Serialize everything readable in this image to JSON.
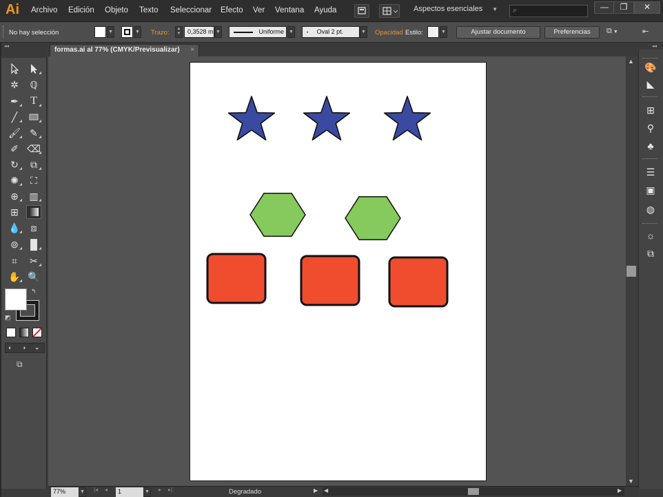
{
  "app": {
    "logo": "Ai"
  },
  "menu": [
    "Archivo",
    "Edición",
    "Objeto",
    "Texto",
    "Seleccionar",
    "Efecto",
    "Ver",
    "Ventana",
    "Ayuda"
  ],
  "workspace": {
    "label": "Aspectos esenciales"
  },
  "search": {
    "placeholder": ""
  },
  "window_controls": {
    "minimize": "—",
    "restore": "❐",
    "close": "✕"
  },
  "control_bar": {
    "selection_status": "No hay selección",
    "stroke_label": "Trazo:",
    "stroke_weight": "0,3528 m",
    "stroke_profile": "Uniforme",
    "brush": "Oval 2 pt.",
    "opacity_label": "Opacidad",
    "style_label": "Estilo:",
    "fit_document_button": "Ajustar documento",
    "preferences_button": "Preferencias"
  },
  "document_tab": {
    "title": "formas.ai al 77% (CMYK/Previsualizar)",
    "close": "×"
  },
  "artwork": {
    "star_color": "#3a4aa0",
    "hexagon_color": "#86c95c",
    "square_color": "#f04d2e",
    "outline_color": "#111111",
    "stars": 3,
    "hexagons": 2,
    "squares": 3
  },
  "status_bar": {
    "zoom": "77%",
    "artboard_number": "1",
    "status_text": "Degradado"
  }
}
